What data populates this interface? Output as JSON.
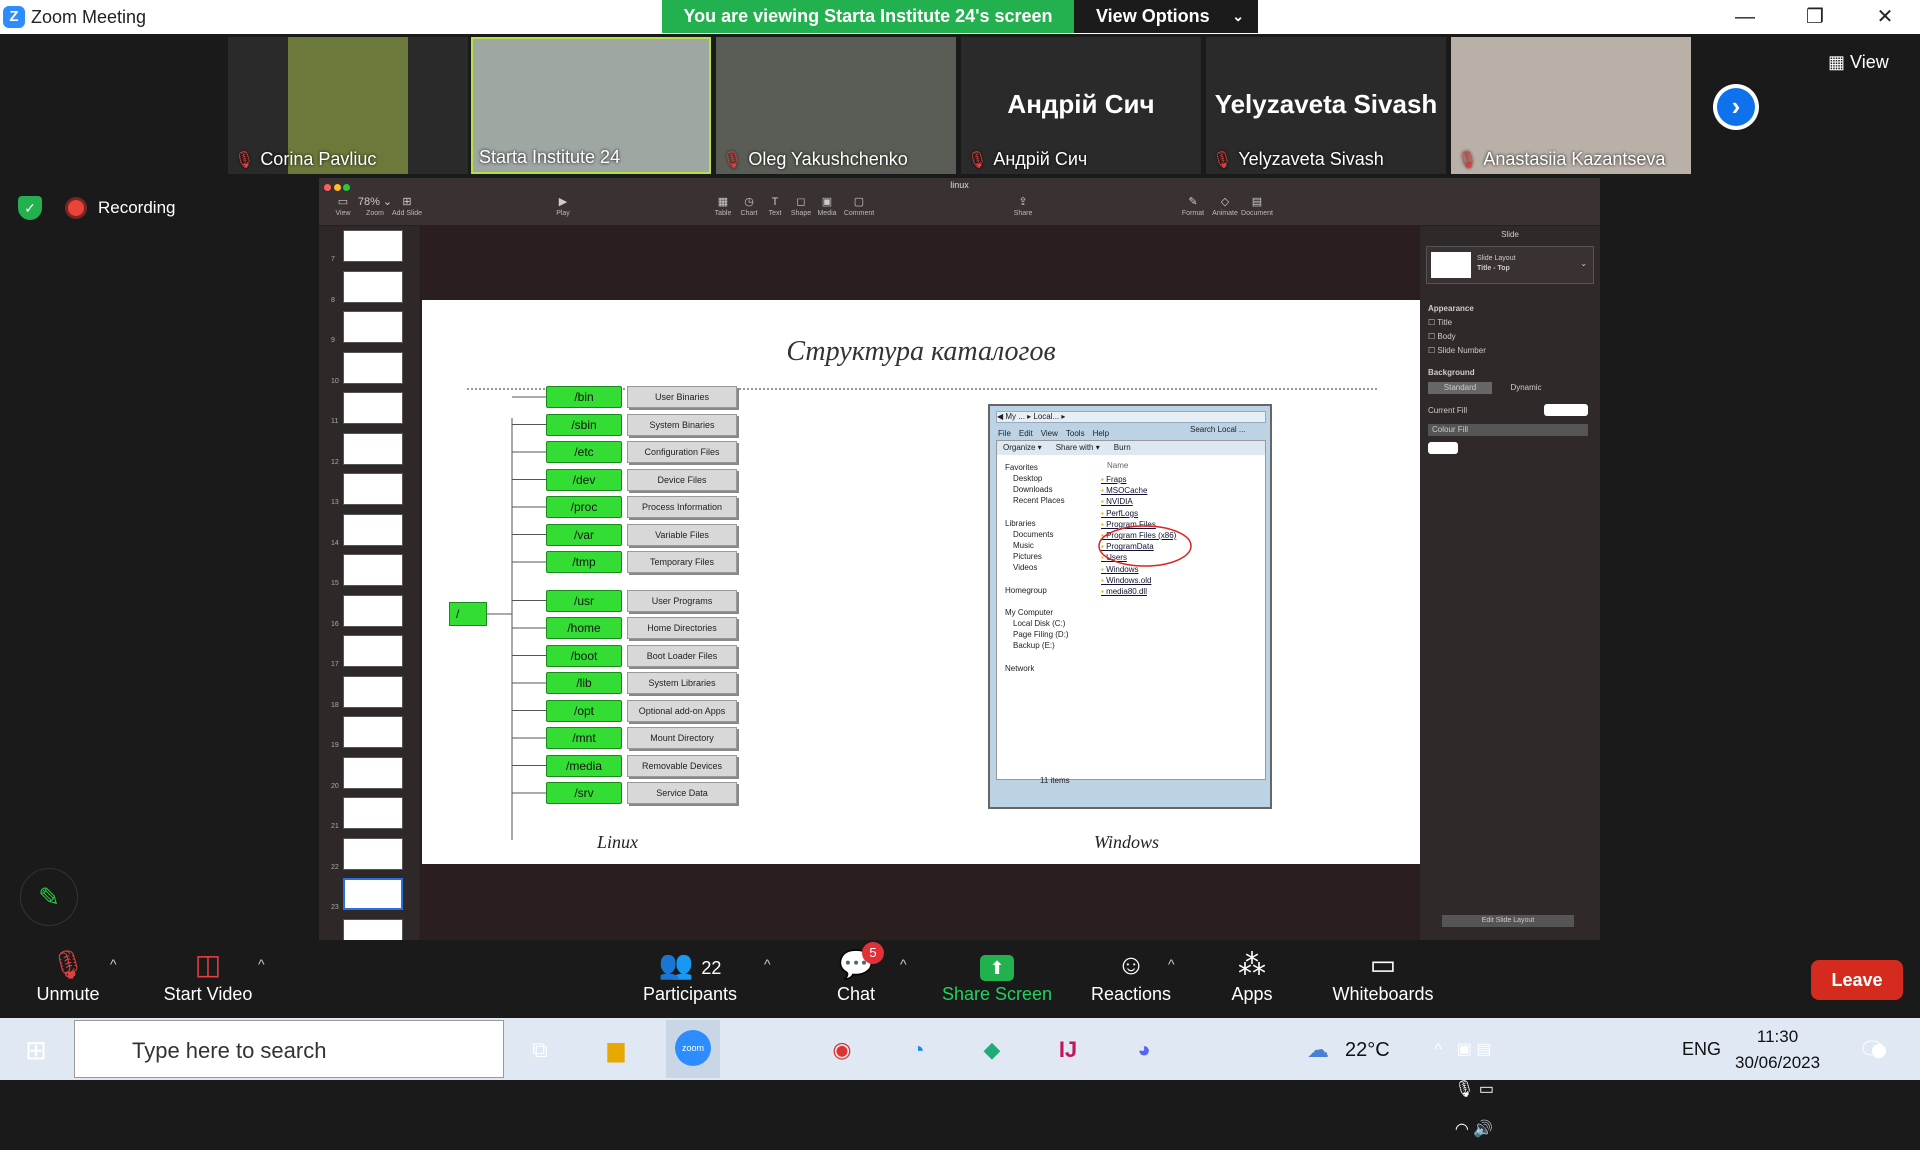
{
  "window": {
    "title": "Zoom Meeting",
    "banner": "You are viewing Starta Institute 24's screen",
    "view_options": "View Options",
    "minimize": "—",
    "maximize": "❐",
    "close": "✕"
  },
  "gallery": {
    "view_label": "View",
    "participants": [
      {
        "name": "Corina Pavliuc",
        "muted": true,
        "video": true
      },
      {
        "name": "Starta Institute 24",
        "muted": false,
        "video": true,
        "active": true
      },
      {
        "name": "Oleg Yakushchenko",
        "muted": true,
        "video": true
      },
      {
        "name": "Андрій Сич",
        "muted": true,
        "video": false,
        "display": "Андрій Сич"
      },
      {
        "name": "Yelyzaveta Sivash",
        "muted": true,
        "video": false,
        "display": "Yelyzaveta Sivash"
      },
      {
        "name": "Anastasiia Kazantseva",
        "muted": true,
        "video": true
      }
    ]
  },
  "recording": "Recording",
  "keynote": {
    "doc_title": "linux",
    "toolbar": [
      {
        "icon": "▭",
        "label": "View"
      },
      {
        "icon": "78% ⌄",
        "label": "Zoom"
      },
      {
        "icon": "⊞",
        "label": "Add Slide"
      },
      {
        "icon": "▶",
        "label": "Play"
      },
      {
        "icon": "▦",
        "label": "Table"
      },
      {
        "icon": "◷",
        "label": "Chart"
      },
      {
        "icon": "T",
        "label": "Text"
      },
      {
        "icon": "◻",
        "label": "Shape"
      },
      {
        "icon": "▣",
        "label": "Media"
      },
      {
        "icon": "▢",
        "label": "Comment"
      },
      {
        "icon": "⇪",
        "label": "Share"
      },
      {
        "icon": "✎",
        "label": "Format"
      },
      {
        "icon": "◇",
        "label": "Animate"
      },
      {
        "icon": "▤",
        "label": "Document"
      }
    ],
    "slide_numbers": [
      "7",
      "8",
      "9",
      "10",
      "11",
      "12",
      "13",
      "14",
      "15",
      "16",
      "17",
      "18",
      "19",
      "20",
      "21",
      "22",
      "23",
      "24"
    ],
    "inspector": {
      "header": "Slide",
      "layout_label": "Slide Layout",
      "layout_value": "Title - Top",
      "appearance": "Appearance",
      "opt_title": "Title",
      "opt_body": "Body",
      "opt_slide_number": "Slide Number",
      "background": "Background",
      "standard": "Standard",
      "dynamic": "Dynamic",
      "current_fill": "Current Fill",
      "colour_fill": "Colour Fill",
      "edit_layout": "Edit Slide Layout"
    },
    "slide": {
      "title": "Структура каталогов",
      "root": "/",
      "dirs": [
        {
          "name": "/bin",
          "desc": "User Binaries"
        },
        {
          "name": "/sbin",
          "desc": "System Binaries"
        },
        {
          "name": "/etc",
          "desc": "Configuration Files"
        },
        {
          "name": "/dev",
          "desc": "Device Files"
        },
        {
          "name": "/proc",
          "desc": "Process Information"
        },
        {
          "name": "/var",
          "desc": "Variable Files"
        },
        {
          "name": "/tmp",
          "desc": "Temporary Files"
        },
        {
          "name": "/usr",
          "desc": "User Programs"
        },
        {
          "name": "/home",
          "desc": "Home Directories"
        },
        {
          "name": "/boot",
          "desc": "Boot Loader Files"
        },
        {
          "name": "/lib",
          "desc": "System Libraries"
        },
        {
          "name": "/opt",
          "desc": "Optional add-on Apps"
        },
        {
          "name": "/mnt",
          "desc": "Mount Directory"
        },
        {
          "name": "/media",
          "desc": "Removable Devices"
        },
        {
          "name": "/srv",
          "desc": "Service Data"
        }
      ],
      "caption_linux": "Linux",
      "caption_windows": "Windows",
      "explorer": {
        "address": "My ... ▸ Local... ▸",
        "search": "Search Local ...",
        "menu": [
          "File",
          "Edit",
          "View",
          "Tools",
          "Help"
        ],
        "commands": [
          "Organize ▾",
          "Share with ▾",
          "Burn"
        ],
        "nav": [
          "Favorites",
          "Desktop",
          "Downloads",
          "Recent Places",
          "Libraries",
          "Documents",
          "Music",
          "Pictures",
          "Videos",
          "Homegroup",
          "My Computer",
          "Local Disk (C:)",
          "Page Filing (D:)",
          "Backup (E:)",
          "Network"
        ],
        "col_name": "Name",
        "files": [
          "Fraps",
          "MSOCache",
          "NVIDIA",
          "PerfLogs",
          "Program Files",
          "Program Files (x86)",
          "ProgramData",
          "Users",
          "Windows",
          "Windows.old",
          "media80.dll"
        ],
        "status": "11 items"
      }
    }
  },
  "toolbar": {
    "unmute": "Unmute",
    "start_video": "Start Video",
    "participants_count": "22",
    "participants": "Participants",
    "chat_badge": "5",
    "chat": "Chat",
    "share": "Share Screen",
    "reactions": "Reactions",
    "apps": "Apps",
    "whiteboards": "Whiteboards",
    "leave": "Leave"
  },
  "taskbar": {
    "search_placeholder": "Type here to search",
    "zoom_label": "zoom",
    "temp": "22°C",
    "lang": "ENG",
    "time": "11:30",
    "date": "30/06/2023",
    "notif": "1"
  },
  "colors": {
    "share_green": "#23b150",
    "zoom_blue": "#2D8CFF",
    "leave_red": "#d52b1e",
    "dir_green": "#33dd33"
  }
}
